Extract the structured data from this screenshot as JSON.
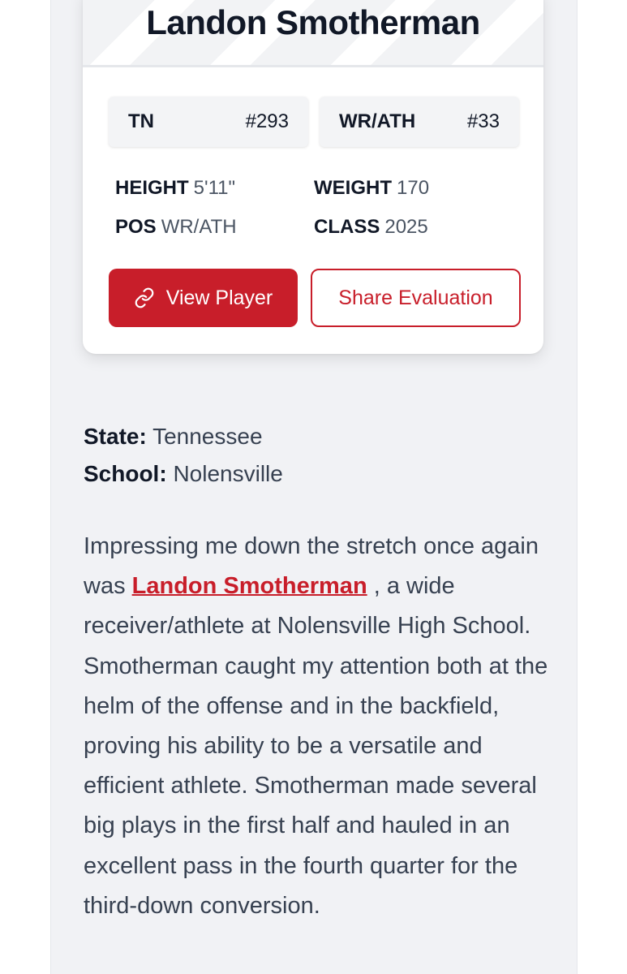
{
  "player": {
    "name": "Landon Smotherman",
    "state_code": "TN",
    "state_rank": "#293",
    "position_code": "WR/ATH",
    "position_rank": "#33",
    "stats": {
      "height_label": "HEIGHT",
      "height": "5'11\"",
      "weight_label": "WEIGHT",
      "weight": "170",
      "pos_label": "POS",
      "pos": "WR/ATH",
      "class_label": "CLASS",
      "class": "2025"
    },
    "buttons": {
      "view": "View Player",
      "share": "Share Evaluation"
    }
  },
  "meta": {
    "state_label": "State:",
    "state": "Tennessee",
    "school_label": "School:",
    "school": "Nolensville"
  },
  "article": {
    "before_link": "Impressing me down the stretch once again was ",
    "link_text": "Landon Smotherman",
    "after_link": " , a wide receiver/athlete at Nolensville High School. Smotherman caught my attention both at the helm of the offense and in the backfield, proving his ability to be a versatile and efficient athlete. Smotherman made several big plays in the first half and hauled in an excellent pass in the fourth quarter for the third-down conversion."
  },
  "colors": {
    "accent": "#c81e2a",
    "panel": "#f1f2f5",
    "text": "#111827"
  },
  "icons": {
    "view_button": "link-icon"
  }
}
